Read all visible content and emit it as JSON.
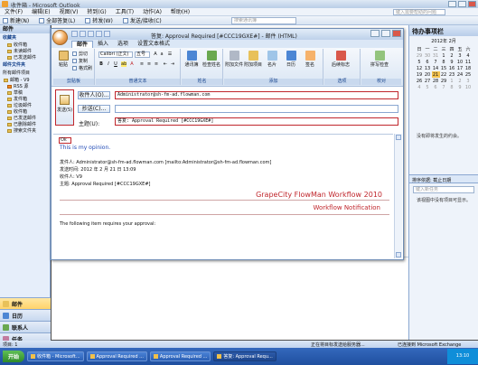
{
  "outlook": {
    "title": "收件箱 - Microsoft Outlook",
    "menu": [
      "文件(F)",
      "编辑(E)",
      "视图(V)",
      "转到(G)",
      "工具(T)",
      "动作(A)",
      "帮助(H)"
    ],
    "help_placeholder": "键入需要帮助的问题",
    "toolbar": [
      "新建(N)",
      "全部答复(L)",
      "转发(W)",
      "发送/接收(C)"
    ],
    "search_placeholder": "搜索通讯簿"
  },
  "nav": {
    "title": "邮件",
    "fav_section": "收藏夹",
    "fav_items": [
      "收件箱",
      "未读邮件",
      "已发送邮件"
    ],
    "folders_section": "邮件文件夹",
    "all_items": "所有邮件项目",
    "tree": [
      "邮箱 - V9",
      "RSS 源",
      "草稿",
      "发件箱",
      "垃圾邮件",
      "收件箱",
      "已发送邮件",
      "已删除邮件",
      "搜索文件夹"
    ],
    "buttons": [
      "邮件",
      "日历",
      "联系人",
      "任务"
    ]
  },
  "todo": {
    "title": "待办事项栏",
    "month": "2012年 2月",
    "weekdays": [
      "日",
      "一",
      "二",
      "三",
      "四",
      "五",
      "六"
    ],
    "weeks": [
      [
        "29",
        "30",
        "31",
        "1",
        "2",
        "3",
        "4"
      ],
      [
        "5",
        "6",
        "7",
        "8",
        "9",
        "10",
        "11"
      ],
      [
        "12",
        "13",
        "14",
        "15",
        "16",
        "17",
        "18"
      ],
      [
        "19",
        "20",
        "21",
        "22",
        "23",
        "24",
        "25"
      ],
      [
        "26",
        "27",
        "28",
        "29",
        "1",
        "2",
        "3"
      ],
      [
        "4",
        "5",
        "6",
        "7",
        "8",
        "9",
        "10"
      ]
    ],
    "no_appointments": "没有即将发生的约会。",
    "task_header": "排序依据: 截止日期",
    "task_placeholder": "键入新任务",
    "task_empty": "该视图中没有项目可显示。"
  },
  "compose": {
    "title": "答复: Approval Required [#CCC19GXE#] - 邮件 (HTML)",
    "tabs": [
      "邮件",
      "插入",
      "选项",
      "设置文本格式"
    ],
    "ribbon": {
      "paste": "粘贴",
      "cut": "剪切",
      "copy": "复制",
      "format_painter": "格式刷",
      "group_clipboard": "剪贴板",
      "font_name": "Calibri (正文)",
      "font_size": "五号",
      "group_basic_text": "普通文本",
      "address_book": "通讯簿",
      "check_names": "检查姓名",
      "group_names": "姓名",
      "attach_file": "附加文件",
      "attach_item": "附加项目",
      "business_card": "名片",
      "calendar": "日历",
      "signature": "签名",
      "group_include": "添加",
      "follow_up": "后续标志",
      "group_options": "选项",
      "spelling": "拼写检查",
      "group_proofing": "校对"
    },
    "send_label": "发送(S)",
    "to_button": "收件人(O)...",
    "cc_button": "抄送(C)...",
    "subject_label": "主题(U):",
    "to_value": "Administrator@sh-fm-ad.flowman.com",
    "cc_value": "",
    "subject_value": "答复: Approval Required [#CCC19GXE#]"
  },
  "body": {
    "ok": "Ok",
    "option_text": "This is my opinion.",
    "from_line": "发件人: Administrator@sh-fm-ad.flowman.com [mailto:Administrator@sh-fm-ad.flowman.com]",
    "sent_line": "发送时间: 2012 年 2 月 21 日 13:09",
    "to_line": "收件人: V9",
    "subject_line": "主题: Approval Required [#CCC19GXE#]",
    "brand_title": "GrapeCity FlowMan Workflow 2010",
    "brand_sub": "Workflow Notification",
    "request": "The following item requires your approval:"
  },
  "status": {
    "left": "项目: 1",
    "mid": "正在将目标发送给服务器...",
    "right": "已连接到 Microsoft Exchange"
  },
  "taskbar": {
    "start": "开始",
    "items": [
      "收件箱 - Microsoft...",
      "Approval Required ...",
      "Approval Required ...",
      "答复: Approval Requ..."
    ],
    "clock": "13:10"
  }
}
